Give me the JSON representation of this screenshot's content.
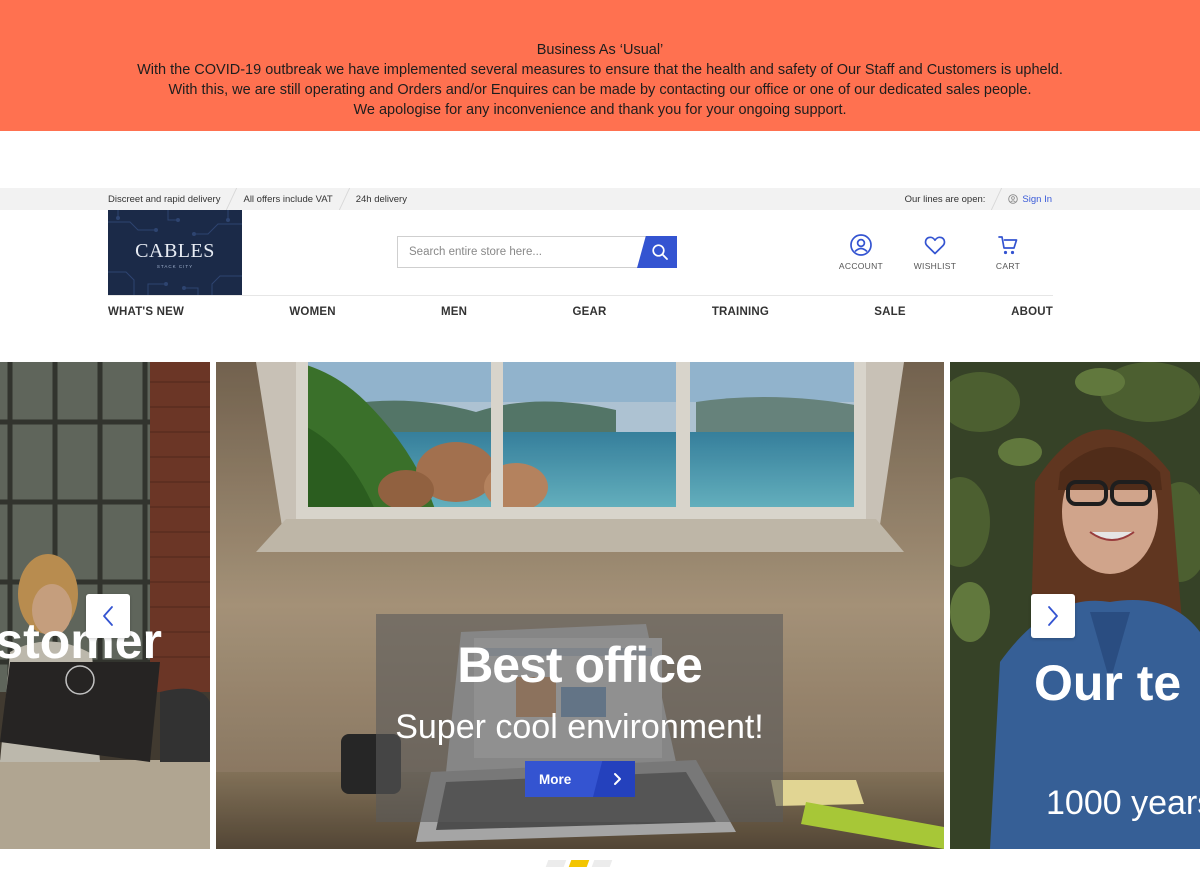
{
  "notice": {
    "title": "Business As ‘Usual’",
    "lines": [
      "With the COVID-19 outbreak we have implemented several measures to ensure that the health and safety of Our Staff and Customers is upheld.",
      "With this, we are still operating and Orders and/or Enquires can be made by contacting our office or one of our dedicated sales people.",
      "We apologise for any inconvenience and thank you for your ongoing support."
    ]
  },
  "topbar": {
    "items": [
      "Discreet and rapid delivery",
      "All offers include VAT",
      "24h delivery"
    ],
    "lines_open": "Our lines are open:",
    "sign_in": "Sign In"
  },
  "logo": {
    "brand": "CABLES",
    "tagline": "STACK CITY"
  },
  "search": {
    "placeholder": "Search entire store here..."
  },
  "header_icons": {
    "account": "ACCOUNT",
    "wishlist": "WISHLIST",
    "cart": "CART"
  },
  "nav": [
    "WHAT'S NEW",
    "WOMEN",
    "MEN",
    "GEAR",
    "TRAINING",
    "SALE",
    "ABOUT"
  ],
  "carousel": {
    "left": {
      "title": "stomer"
    },
    "center": {
      "title": "Best office",
      "subtitle": "Super cool environment!",
      "button": "More"
    },
    "right": {
      "title": "Our te",
      "subtitle": "1000 years"
    },
    "active_index": 1,
    "dot_count": 3
  },
  "colors": {
    "accent": "#3454d1",
    "notice": "#ff7150",
    "dot_active": "#f3c500",
    "logo_bg": "#1b2a48"
  }
}
